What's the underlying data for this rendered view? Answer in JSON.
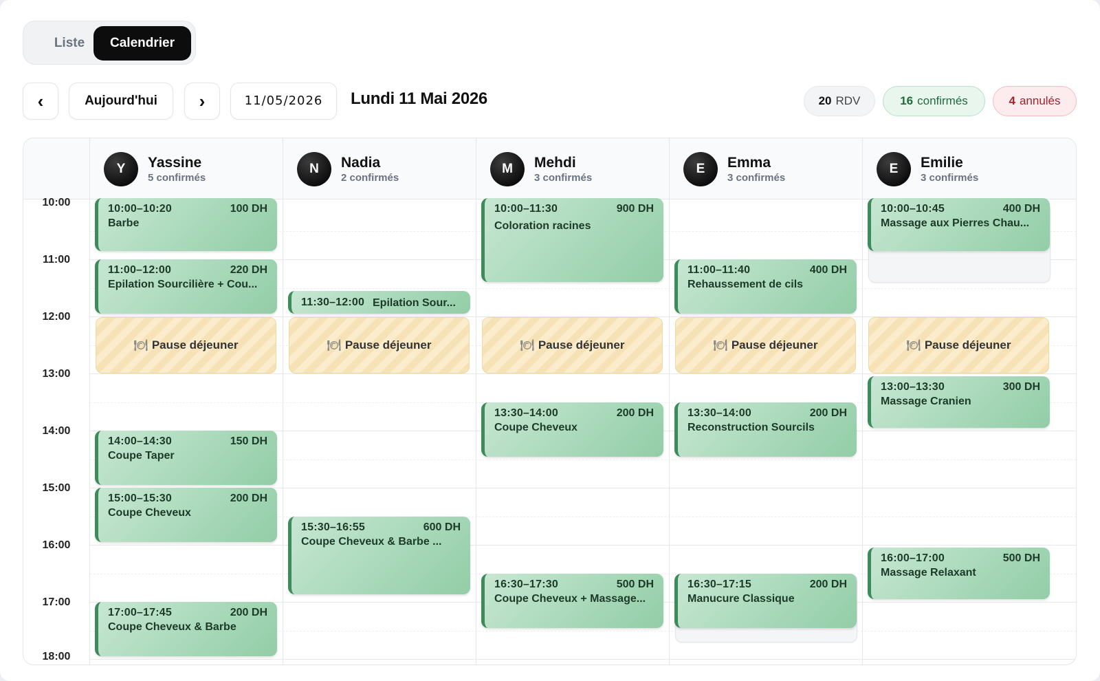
{
  "view_toggle": {
    "list_label": "Liste",
    "calendar_label": "Calendrier",
    "active": "Calendrier"
  },
  "nav": {
    "prev_icon": "‹",
    "today_label": "Aujourd'hui",
    "next_icon": "›",
    "date_value": "11/05/2026",
    "day_title": "Lundi 11 Mai 2026"
  },
  "stats": {
    "total_count": "20",
    "total_label": "RDV",
    "confirmed_count": "16",
    "confirmed_label": "confirmés",
    "cancelled_count": "4",
    "cancelled_label": "annulés"
  },
  "hours": [
    "10:00",
    "11:00",
    "12:00",
    "13:00",
    "14:00",
    "15:00",
    "16:00",
    "17:00",
    "18:00"
  ],
  "pause_label": "Pause déjeuner",
  "pause_icon": "🍽",
  "employees": [
    {
      "initial": "Y",
      "name": "Yassine",
      "sub": "5 confirmés",
      "appointments": [
        {
          "time": "10:00–10:20",
          "price": "100 DH",
          "name": "Barbe",
          "start": 10.0,
          "end": 10.9
        },
        {
          "time": "11:00–12:00",
          "price": "220 DH",
          "name": "Epilation Sourcilière + Cou...",
          "start": 11.0,
          "end": 12.0
        },
        {
          "time": "14:00–14:30",
          "price": "150 DH",
          "name": "Coupe Taper",
          "start": 14.0,
          "end": 15.0
        },
        {
          "time": "15:00–15:30",
          "price": "200 DH",
          "name": "Coupe Cheveux",
          "start": 15.0,
          "end": 16.0
        },
        {
          "time": "17:00–17:45",
          "price": "200 DH",
          "name": "Coupe Cheveux & Barbe",
          "start": 17.0,
          "end": 18.0
        }
      ],
      "ghosts": []
    },
    {
      "initial": "N",
      "name": "Nadia",
      "sub": "2 confirmés",
      "appointments": [
        {
          "time": "11:30–12:00",
          "price": "",
          "name": "Epilation Sour...",
          "start": 11.55,
          "end": 12.0,
          "inline": true
        },
        {
          "time": "15:30–16:55",
          "price": "600 DH",
          "name": "Coupe Cheveux & Barbe ...",
          "start": 15.5,
          "end": 16.92
        }
      ],
      "ghosts": []
    },
    {
      "initial": "M",
      "name": "Mehdi",
      "sub": "3 confirmés",
      "appointments": [
        {
          "time": "10:00–11:30",
          "price": "900 DH",
          "name": "Coloration racines",
          "start": 10.0,
          "end": 11.45,
          "tall": true
        },
        {
          "time": "13:30–14:00",
          "price": "200 DH",
          "name": "Coupe Cheveux",
          "start": 13.5,
          "end": 14.5
        },
        {
          "time": "16:30–17:30",
          "price": "500 DH",
          "name": "Coupe Cheveux + Massage...",
          "start": 16.5,
          "end": 17.5
        }
      ],
      "ghosts": []
    },
    {
      "initial": "E",
      "name": "Emma",
      "sub": "3 confirmés",
      "appointments": [
        {
          "time": "11:00–11:40",
          "price": "400 DH",
          "name": "Rehaussement de cils",
          "start": 11.0,
          "end": 12.0
        },
        {
          "time": "13:30–14:00",
          "price": "200 DH",
          "name": "Reconstruction Sourcils",
          "start": 13.5,
          "end": 14.5
        },
        {
          "time": "16:30–17:15",
          "price": "200 DH",
          "name": "Manucure Classique",
          "start": 16.5,
          "end": 17.5
        }
      ],
      "ghosts": [
        {
          "start": 16.5,
          "end": 17.75
        }
      ]
    },
    {
      "initial": "E",
      "name": "Emilie",
      "sub": "3 confirmés",
      "appointments": [
        {
          "time": "10:00–10:45",
          "price": "400 DH",
          "name": "Massage aux Pierres Chau...",
          "start": 10.0,
          "end": 10.9
        },
        {
          "time": "13:00–13:30",
          "price": "300 DH",
          "name": "Massage Cranien",
          "start": 13.05,
          "end": 14.0
        },
        {
          "time": "16:00–17:00",
          "price": "500 DH",
          "name": "Massage Relaxant",
          "start": 16.05,
          "end": 17.0
        }
      ],
      "ghosts": [
        {
          "start": 10.0,
          "end": 11.45
        }
      ]
    }
  ]
}
